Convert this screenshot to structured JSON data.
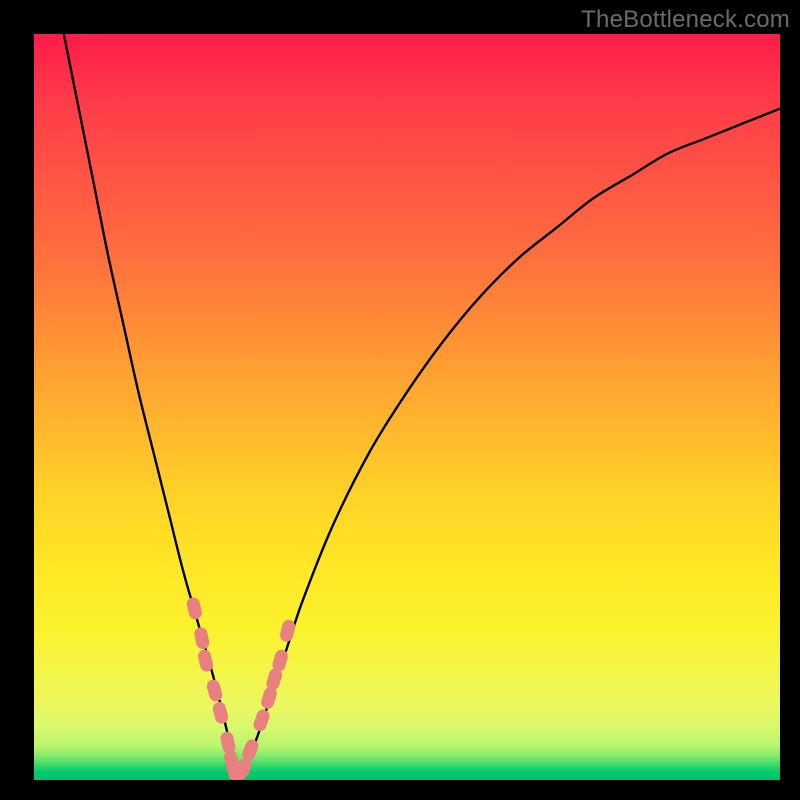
{
  "watermark": "TheBottleneck.com",
  "colors": {
    "frame": "#000000",
    "curve": "#000000",
    "marker": "#e98080",
    "gradient_stops": [
      {
        "pos": 0.0,
        "hex": "#ff1c4a"
      },
      {
        "pos": 0.28,
        "hex": "#ff6a3f"
      },
      {
        "pos": 0.62,
        "hex": "#ffd327"
      },
      {
        "pos": 0.86,
        "hex": "#f3f64a"
      },
      {
        "pos": 0.97,
        "hex": "#7ae86a"
      },
      {
        "pos": 1.0,
        "hex": "#00c170"
      }
    ]
  },
  "chart_data": {
    "type": "line",
    "title": "",
    "xlabel": "",
    "ylabel": "",
    "xlim": [
      0,
      100
    ],
    "ylim": [
      0,
      100
    ],
    "grid": false,
    "series": [
      {
        "name": "bottleneck-curve",
        "x": [
          4,
          6,
          8,
          10,
          12,
          14,
          16,
          18,
          20,
          22,
          24,
          26,
          27,
          28,
          30,
          32,
          34,
          36,
          40,
          45,
          50,
          55,
          60,
          65,
          70,
          75,
          80,
          85,
          90,
          95,
          100
        ],
        "y": [
          100,
          90,
          80,
          70,
          61,
          52,
          44,
          36,
          28,
          21,
          14,
          6,
          1,
          1,
          6,
          12,
          18,
          24,
          34,
          44,
          52,
          59,
          65,
          70,
          74,
          78,
          81,
          84,
          86,
          88,
          90
        ]
      }
    ],
    "markers": {
      "name": "highlighted-points",
      "series_ref": "bottleneck-curve",
      "x": [
        21.5,
        22.5,
        23.0,
        24.2,
        25.0,
        26.0,
        26.5,
        27.0,
        27.5,
        28.0,
        29.0,
        30.5,
        31.5,
        32.2,
        33.0,
        34.0
      ],
      "y": [
        23.0,
        19.0,
        16.0,
        12.0,
        9.0,
        5.0,
        2.5,
        1.0,
        1.0,
        1.5,
        4.0,
        8.0,
        11.0,
        13.5,
        16.0,
        20.0
      ]
    }
  }
}
